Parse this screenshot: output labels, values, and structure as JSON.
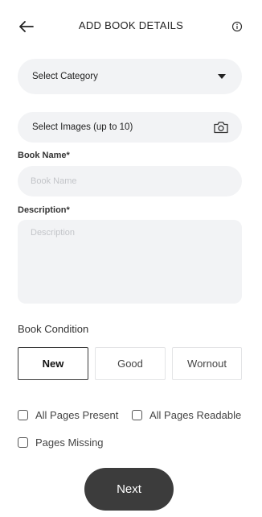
{
  "header": {
    "title": "ADD BOOK DETAILS",
    "back_icon": "arrow-left-icon",
    "info_icon": "info-circle-icon"
  },
  "category_select": {
    "label": "Select Category",
    "icon": "caret-down-icon"
  },
  "images_select": {
    "label": "Select Images (up to 10)",
    "icon": "camera-icon"
  },
  "book_name": {
    "label": "Book Name*",
    "placeholder": "Book Name",
    "value": ""
  },
  "description": {
    "label": "Description*",
    "placeholder": "Description",
    "value": ""
  },
  "condition": {
    "title": "Book Condition",
    "options": [
      "New",
      "Good",
      "Wornout"
    ],
    "selected": "New"
  },
  "checks": {
    "all_pages_present": {
      "label": "All Pages Present",
      "checked": false
    },
    "all_pages_readable": {
      "label": "All Pages Readable",
      "checked": false
    },
    "pages_missing": {
      "label": "Pages Missing",
      "checked": false
    }
  },
  "next_button": {
    "label": "Next"
  },
  "colors": {
    "field_bg": "#f2f3f5",
    "button_dark": "#3c3c3c",
    "placeholder": "#c3c5c9"
  }
}
